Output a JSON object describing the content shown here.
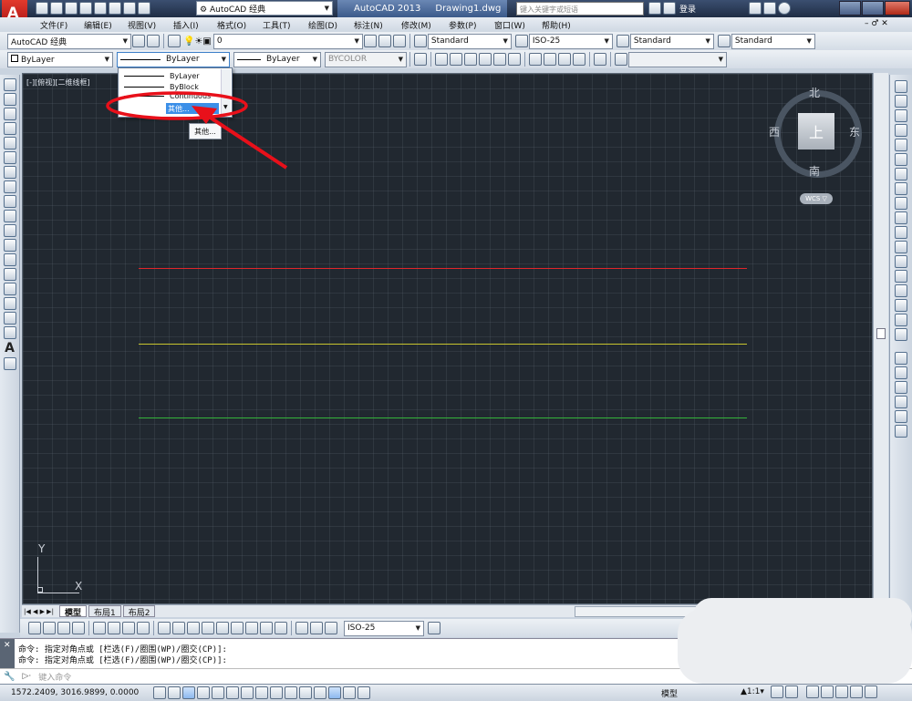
{
  "titlebar": {
    "workspace": "AutoCAD 经典",
    "app_version": "AutoCAD 2013",
    "file_name": "Drawing1.dwg",
    "search_placeholder": "键入关键字或短语",
    "login_label": "登录"
  },
  "menu": [
    "文件(F)",
    "编辑(E)",
    "视图(V)",
    "插入(I)",
    "格式(O)",
    "工具(T)",
    "绘图(D)",
    "标注(N)",
    "修改(M)",
    "参数(P)",
    "窗口(W)",
    "帮助(H)"
  ],
  "toolbar1": {
    "workspace_combo": "AutoCAD 经典",
    "layer_combo": "0",
    "text_style": "Standard",
    "dim_style": "ISO-25",
    "table_style": "Standard",
    "multileader_style": "Standard"
  },
  "toolbar2": {
    "color_combo": "ByLayer",
    "linetype_combo": "ByLayer",
    "lineweight_combo": "ByLayer",
    "plotstyle_combo": "BYCOLOR"
  },
  "linetype_dropdown": {
    "items": [
      "ByLayer",
      "ByBlock",
      "Continuous",
      "其他..."
    ],
    "selected_index": 3,
    "tooltip": "其他..."
  },
  "viewport_label": "[-][俯视][二维线框]",
  "viewcube": {
    "north": "北",
    "south": "南",
    "east": "东",
    "west": "西",
    "top": "上",
    "wcs": "WCS"
  },
  "ucs": {
    "x": "X",
    "y": "Y"
  },
  "tabs": [
    "模型",
    "布局1",
    "布局2"
  ],
  "dimbar": {
    "dim_style": "ISO-25"
  },
  "command_history": [
    "命令: 指定对角点或 [栏选(F)/圈围(WP)/圈交(CP)]:",
    "命令: 指定对角点或 [栏选(F)/圈围(WP)/圈交(CP)]:"
  ],
  "command_placeholder": "键入命令",
  "status": {
    "coords": "1572.2409, 3016.9899, 0.0000",
    "model_label": "模型",
    "scale": "1:1"
  },
  "lines": [
    {
      "name": "red-line",
      "color": "#e0262a"
    },
    {
      "name": "yellow-line",
      "color": "#c7c42e"
    },
    {
      "name": "green-line",
      "color": "#34b43a"
    }
  ],
  "colors": {
    "annotation": "#e8101a"
  }
}
